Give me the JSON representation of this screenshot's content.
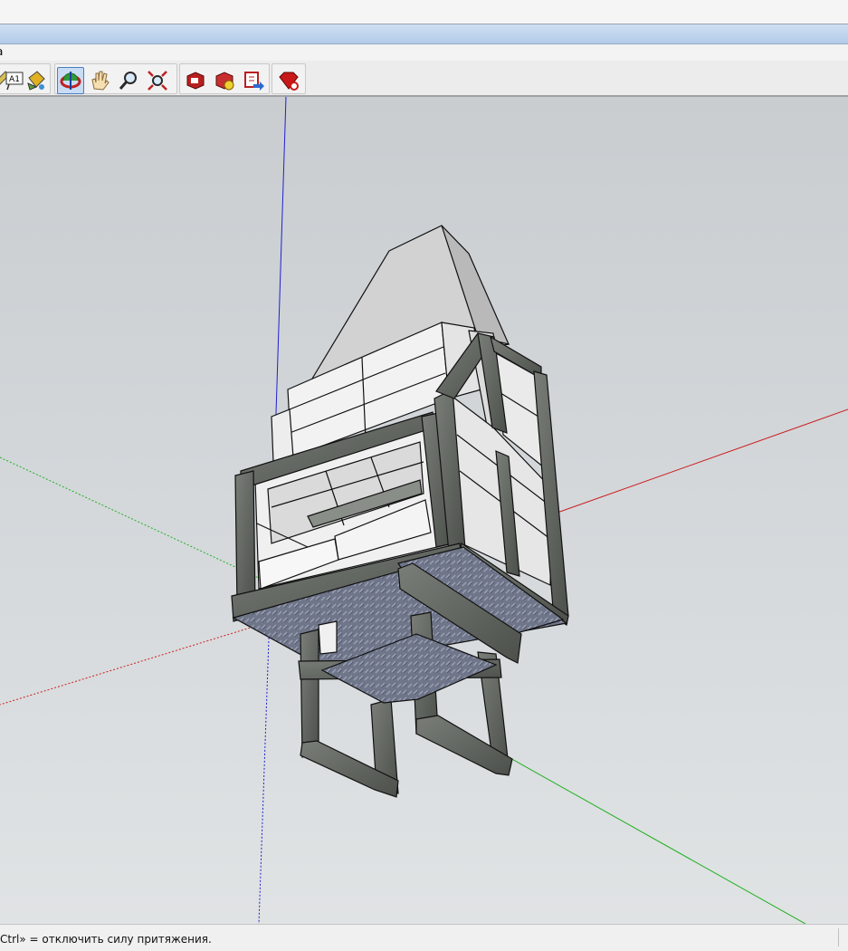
{
  "menu": {
    "partial_label": "а"
  },
  "toolbar": {
    "text_tool_label": "A1",
    "icons": [
      "tape-measure-icon",
      "text-tool-icon",
      "paint-bucket-icon",
      "orbit-icon",
      "pan-hand-icon",
      "zoom-icon",
      "zoom-extents-icon",
      "get-models-icon",
      "share-model-icon",
      "share-component-icon",
      "extension-warehouse-icon"
    ],
    "active_tool": "orbit-icon"
  },
  "colors": {
    "axis_blue": "#2020d0",
    "axis_red": "#cc2020",
    "axis_green": "#20b020",
    "steel_frame": "#5d615c",
    "brick_face": "#f1f1f1",
    "hood": "#d3d3d3",
    "floor_plate": "#6e7480"
  },
  "status": {
    "hint": "Ctrl» = отключить силу притяжения."
  }
}
